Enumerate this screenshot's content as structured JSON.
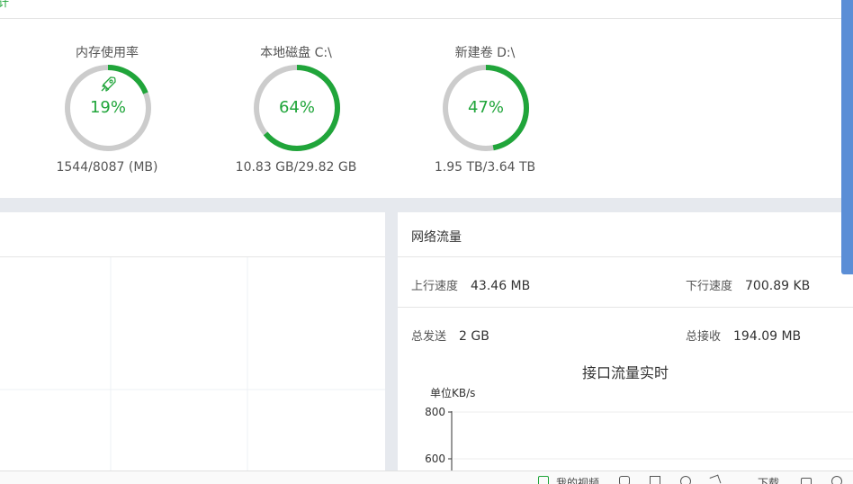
{
  "top": {
    "cut_text": "计"
  },
  "gauges": [
    {
      "title": "内存使用率",
      "percent_label": "19%",
      "percent": 19,
      "detail": "1544/8087 (MB)",
      "icon": "rocket-icon"
    },
    {
      "title": "本地磁盘 C:\\",
      "percent_label": "64%",
      "percent": 64,
      "detail": "10.83 GB/29.82 GB"
    },
    {
      "title": "新建卷 D:\\",
      "percent_label": "47%",
      "percent": 47,
      "detail": "1.95 TB/3.64 TB"
    }
  ],
  "colors": {
    "accent": "#20a53a",
    "track": "#cccccc",
    "panel_bg": "#e6e9ee",
    "edge": "#5b8ed6"
  },
  "network": {
    "title": "网络流量",
    "up_label": "上行速度",
    "up_value": "43.46 MB",
    "down_label": "下行速度",
    "down_value": "700.89 KB",
    "sent_label": "总发送",
    "sent_value": "2 GB",
    "recv_label": "总接收",
    "recv_value": "194.09 MB"
  },
  "chart_data": {
    "type": "line",
    "title": "接口流量实时",
    "ylabel": "单位KB/s",
    "y_ticks": [
      800,
      600
    ],
    "series": []
  },
  "taskbar": {
    "items": [
      {
        "label": "我的视频",
        "icon": "video-icon"
      },
      {
        "label": "",
        "icon": "shield-icon"
      },
      {
        "label": "",
        "icon": "image-icon"
      },
      {
        "label": "",
        "icon": "browser-icon"
      },
      {
        "label": "",
        "icon": "rocket-icon"
      },
      {
        "label": "下载",
        "icon": "download-icon"
      },
      {
        "label": "",
        "icon": "print-icon"
      },
      {
        "label": "",
        "icon": "globe-icon"
      }
    ]
  }
}
